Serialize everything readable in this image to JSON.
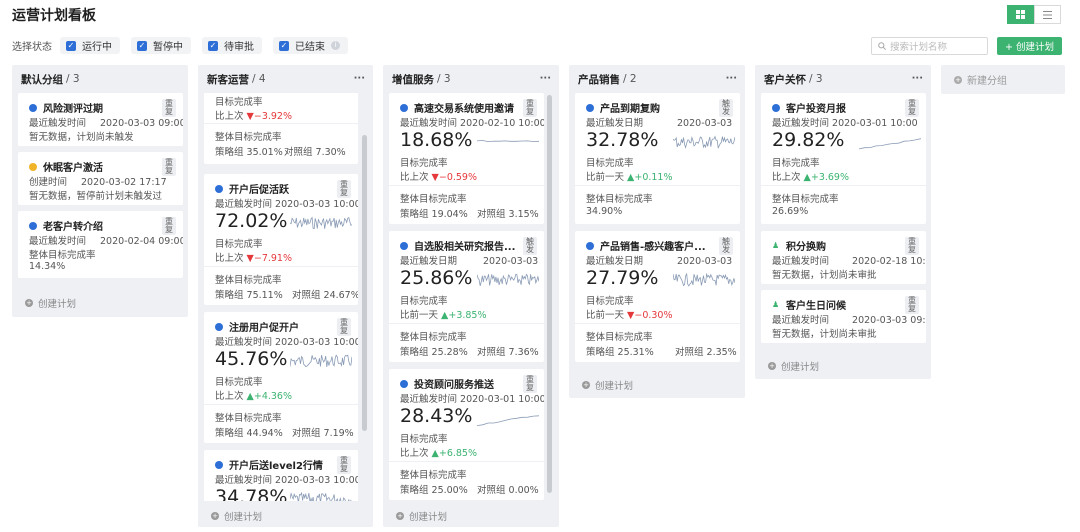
{
  "page_title": "运营计划看板",
  "filter": {
    "label": "选择状态",
    "chips": [
      "运行中",
      "暂停中",
      "待审批",
      "已结束"
    ]
  },
  "search": {
    "placeholder": "搜索计划名称"
  },
  "create_plan_label": "+ 创建计划",
  "create_link_label": "创建计划",
  "new_group_label": "新建分组",
  "tag_label": "重复",
  "tag_label_trigger": "触发",
  "columns": [
    {
      "name": "默认分组",
      "count": "/ 3"
    },
    {
      "name": "新客运营",
      "count": "/ 4"
    },
    {
      "name": "增值服务",
      "count": "/ 3"
    },
    {
      "name": "产品销售",
      "count": "/ 2"
    },
    {
      "name": "客户关怀",
      "count": "/ 3"
    }
  ],
  "col0": [
    {
      "title": "风险测评过期",
      "l1k": "最近触发时间",
      "l1v": "2020-03-03 09:00",
      "l2": "暂无数据，计划尚未触发"
    },
    {
      "title": "休眠客户激活",
      "l1k": "创建时间",
      "l1v": "2020-03-02 17:17",
      "l2": "暂无数据，暂停前计划未触发过"
    },
    {
      "title": "老客户转介绍",
      "l1k": "最近触发时间",
      "l1v": "2020-02-04 09:00",
      "l2": "整体目标完成率",
      "l3": "14.34%"
    }
  ],
  "col1": {
    "partial": {
      "k": "目标完成率",
      "cmp": "比上次",
      "delta": "−3.92%",
      "overall": "整体目标完成率",
      "s": "策略组 35.01%",
      "c": "对照组 7.30%"
    },
    "cards": [
      {
        "title": "开户后促活跃",
        "l1k": "最近触发时间",
        "l1v": "2020-03-03 10:00",
        "pct": "72.02%",
        "k": "目标完成率",
        "cmp": "比上次",
        "delta": "−7.91%",
        "overall": "整体目标完成率",
        "s": "策略组 75.11%",
        "c": "对照组 24.67%"
      },
      {
        "title": "注册用户促开户",
        "l1k": "最近触发时间",
        "l1v": "2020-03-03 10:00",
        "pct": "45.76%",
        "k": "目标完成率",
        "cmp": "比上次",
        "delta": "+4.36%",
        "overall": "整体目标完成率",
        "s": "策略组 44.94%",
        "c": "对照组 7.19%"
      },
      {
        "title": "开户后送level2行情",
        "l1k": "最近触发时间",
        "l1v": "2020-03-03 10:00",
        "pct": "34.78%"
      }
    ]
  },
  "col2": [
    {
      "title": "高速交易系统使用邀请",
      "l1k": "最近触发时间",
      "l1v": "2020-02-10 10:00",
      "pct": "18.68%",
      "k": "目标完成率",
      "cmp": "比上次",
      "delta": "−0.59%",
      "overall": "整体目标完成率",
      "s": "策略组 19.04%",
      "c": "对照组 3.15%"
    },
    {
      "title": "自选股相关研究报告...",
      "l1k": "最近触发日期",
      "l1v": "2020-03-03",
      "pct": "25.86%",
      "k": "目标完成率",
      "cmp": "比前一天",
      "delta": "+3.85%",
      "overall": "整体目标完成率",
      "s": "策略组 25.28%",
      "c": "对照组 7.36%"
    },
    {
      "title": "投资顾问服务推送",
      "l1k": "最近触发时间",
      "l1v": "2020-03-01 10:00",
      "pct": "28.43%",
      "k": "目标完成率",
      "cmp": "比上次",
      "delta": "+6.85%",
      "overall": "整体目标完成率",
      "s": "策略组 25.00%",
      "c": "对照组 0.00%"
    }
  ],
  "col3": [
    {
      "title": "产品到期复购",
      "l1k": "最近触发日期",
      "l1v": "2020-03-03",
      "pct": "32.78%",
      "k": "目标完成率",
      "cmp": "比前一天",
      "delta": "+0.11%",
      "overall": "整体目标完成率",
      "s": "34.90%"
    },
    {
      "title": "产品销售-感兴趣客户...",
      "l1k": "最近触发日期",
      "l1v": "2020-03-03",
      "pct": "27.79%",
      "k": "目标完成率",
      "cmp": "比前一天",
      "delta": "−0.30%",
      "overall": "整体目标完成率",
      "s": "策略组 25.31%",
      "c": "对照组 2.35%"
    }
  ],
  "col4": [
    {
      "title": "客户投资月报",
      "l1k": "最近触发时间",
      "l1v": "2020-03-01 10:00",
      "pct": "29.82%",
      "k": "目标完成率",
      "cmp": "比上次",
      "delta": "+3.69%",
      "overall": "整体目标完成率",
      "s": "26.69%"
    },
    {
      "title": "积分换购",
      "l1k": "最近触发时间",
      "l1v": "2020-02-18 10:00",
      "l2": "暂无数据，计划尚未审批"
    },
    {
      "title": "客户生日问候",
      "l1k": "最近触发时间",
      "l1v": "2020-03-03 09:00",
      "l2": "暂无数据，计划尚未审批"
    }
  ],
  "colors": {
    "accent": "#3cb371",
    "status_running": "#2d6fd6",
    "status_paused": "#f0b429",
    "up": "#3cb371",
    "down": "#e5383b"
  }
}
